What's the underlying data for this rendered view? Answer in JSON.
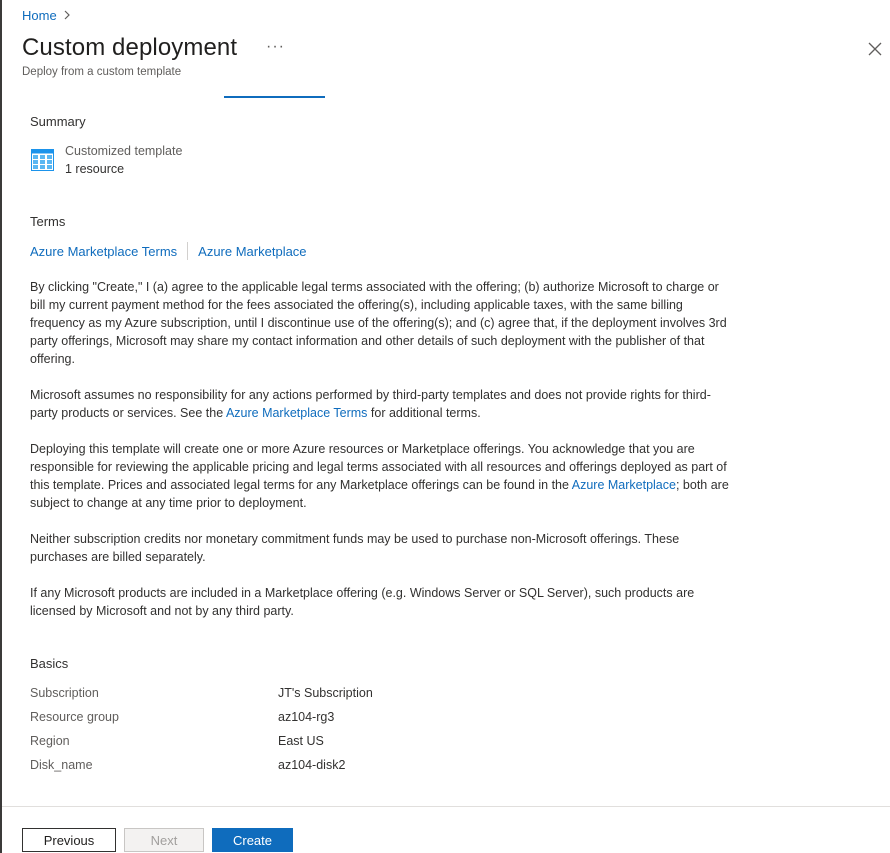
{
  "breadcrumb": {
    "home": "Home"
  },
  "header": {
    "title": "Custom deployment",
    "subtitle": "Deploy from a custom template",
    "more": "···"
  },
  "summary": {
    "heading": "Summary",
    "template_name": "Customized template",
    "resource_count": "1 resource"
  },
  "terms": {
    "heading": "Terms",
    "link1": "Azure Marketplace Terms",
    "link2": "Azure Marketplace",
    "p1": "By clicking \"Create,\" I (a) agree to the applicable legal terms associated with the offering; (b) authorize Microsoft to charge or bill my current payment method for the fees associated the offering(s), including applicable taxes, with the same billing frequency as my Azure subscription, until I discontinue use of the offering(s); and (c) agree that, if the deployment involves 3rd party offerings, Microsoft may share my contact information and other details of such deployment with the publisher of that offering.",
    "p2_a": "Microsoft assumes no responsibility for any actions performed by third-party templates and does not provide rights for third-party products or services. See the ",
    "p2_link": "Azure Marketplace Terms",
    "p2_b": " for additional terms.",
    "p3_a": "Deploying this template will create one or more Azure resources or Marketplace offerings.  You acknowledge that you are responsible for reviewing the applicable pricing and legal terms associated with all resources and offerings deployed as part of this template.  Prices and associated legal terms for any Marketplace offerings can be found in the ",
    "p3_link": "Azure Marketplace",
    "p3_b": "; both are subject to change at any time prior to deployment.",
    "p4": "Neither subscription credits nor monetary commitment funds may be used to purchase non-Microsoft offerings. These purchases are billed separately.",
    "p5": "If any Microsoft products are included in a Marketplace offering (e.g. Windows Server or SQL Server), such products are licensed by Microsoft and not by any third party."
  },
  "basics": {
    "heading": "Basics",
    "rows": [
      {
        "label": "Subscription",
        "value": "JT's Subscription"
      },
      {
        "label": "Resource group",
        "value": "az104-rg3"
      },
      {
        "label": "Region",
        "value": "East US"
      },
      {
        "label": "Disk_name",
        "value": "az104-disk2"
      }
    ]
  },
  "footer": {
    "previous": "Previous",
    "next": "Next",
    "create": "Create"
  },
  "colors": {
    "accent": "#0f6cbd",
    "text": "#323130",
    "muted": "#605e5c"
  },
  "icons": {
    "breadcrumb_chevron": "chevron-right-icon",
    "close": "close-icon",
    "template": "template-grid-icon"
  }
}
